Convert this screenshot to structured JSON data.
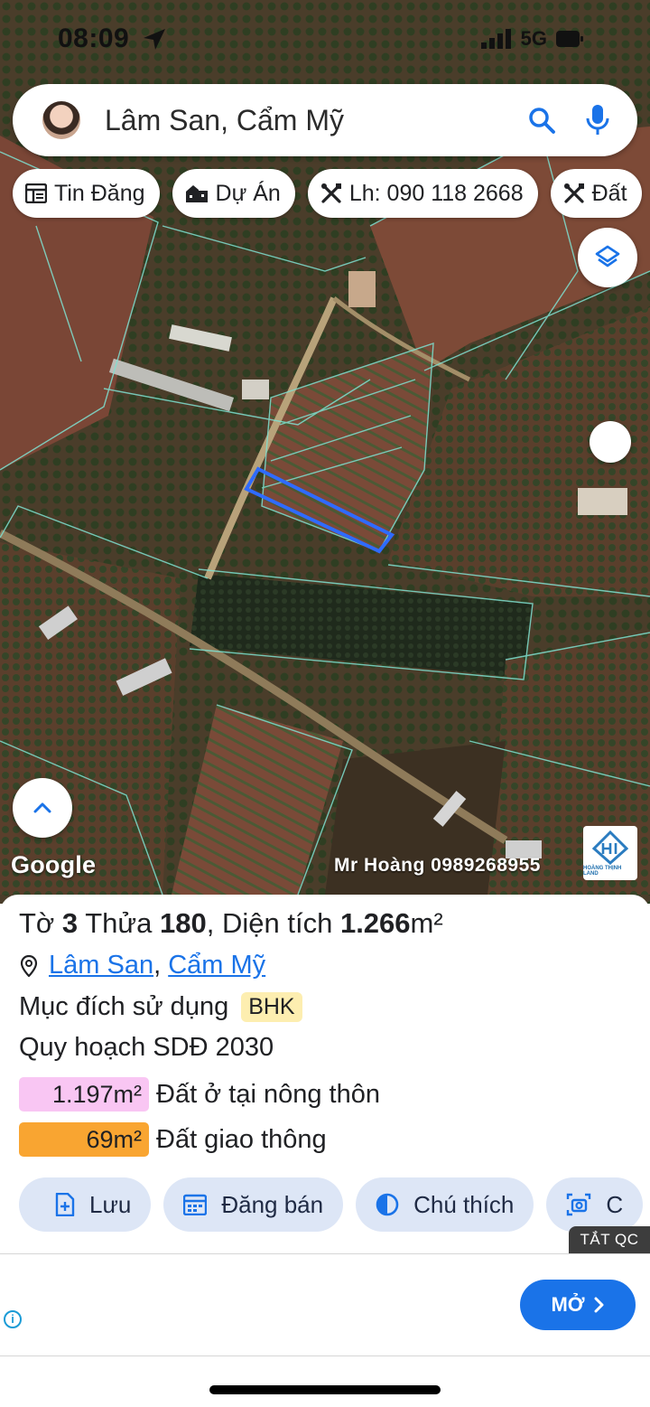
{
  "status_bar": {
    "time": "08:09",
    "network": "5G"
  },
  "search": {
    "query": "Lâm San, Cẩm Mỹ"
  },
  "chips": [
    {
      "icon": "newspaper-icon",
      "label": "Tin Đăng"
    },
    {
      "icon": "buildings-icon",
      "label": "Dự Án"
    },
    {
      "icon": "tools-icon",
      "label": "Lh: 090 118 2668"
    },
    {
      "icon": "tools-icon",
      "label": "Đất"
    }
  ],
  "map": {
    "attribution": "Google",
    "watermark": "Mr Hoàng 0989268955",
    "logo_text": "HOÀNG THỊNH LAND"
  },
  "parcel": {
    "sheet_label": "Tờ",
    "sheet_no": "3",
    "lot_label": "Thửa",
    "lot_no": "180",
    "area_label": "Diện tích",
    "area_value": "1.266",
    "area_unit": "m²",
    "location_1": "Lâm San",
    "location_2": "Cẩm Mỹ",
    "purpose_label": "Mục đích sử dụng",
    "purpose_code": "BHK",
    "plan_label": "Quy hoạch SDĐ 2030",
    "zones": [
      {
        "area": "1.197m²",
        "label": "Đất ở tại nông thôn",
        "color": "#f9c6f3"
      },
      {
        "area": "69m²",
        "label": "Đất giao thông",
        "color": "#f9a531"
      }
    ]
  },
  "actions": [
    {
      "icon": "add-document-icon",
      "label": "Lưu"
    },
    {
      "icon": "calendar-icon",
      "label": "Đăng bán"
    },
    {
      "icon": "contrast-icon",
      "label": "Chú thích"
    },
    {
      "icon": "camera-icon",
      "label": "C"
    }
  ],
  "ad": {
    "close_label": "TẮT QC",
    "open_label": "MỞ",
    "info": "i"
  },
  "colors": {
    "accent": "#1a73e8",
    "parcel_outline": "#2f6bff",
    "action_bg": "#dde6f6"
  }
}
